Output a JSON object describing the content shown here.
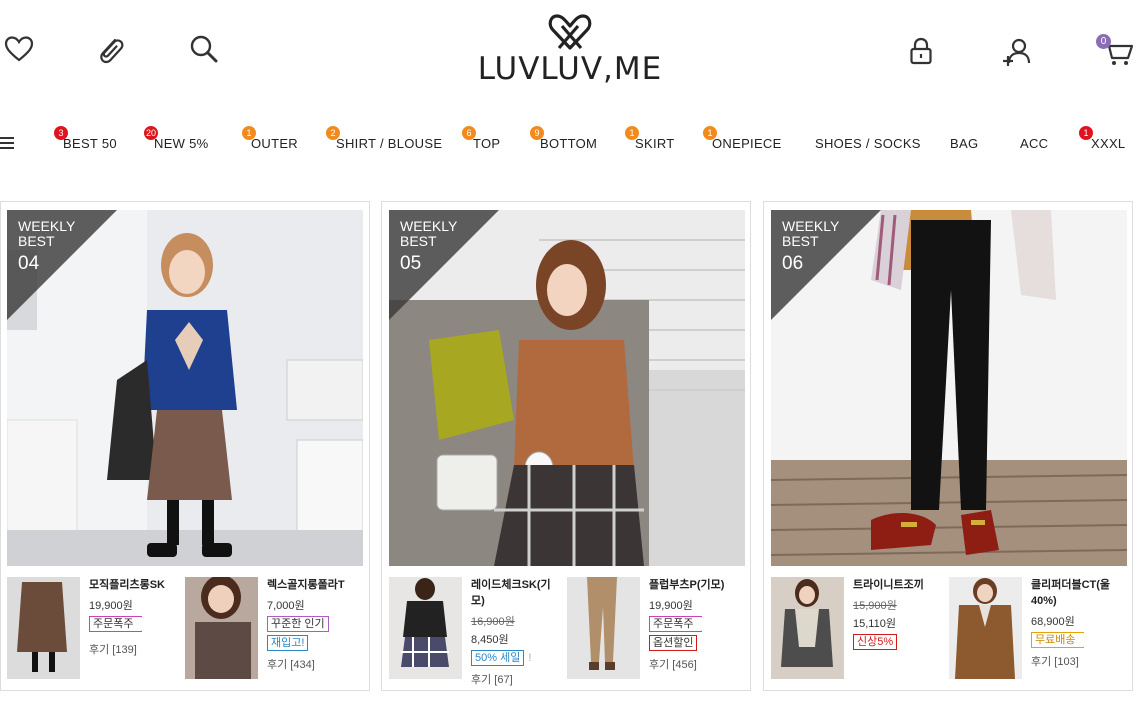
{
  "brand": {
    "name": "LUVLUV,ME"
  },
  "header": {
    "left_icons": [
      "heart-icon",
      "paperclip-icon",
      "search-icon"
    ],
    "right_icons": [
      "lock-icon",
      "add-user-icon",
      "cart-icon"
    ],
    "cart_count": "0"
  },
  "nav": {
    "items": [
      {
        "label": "BEST 50",
        "badge": "3",
        "badge_color": "#e0141e"
      },
      {
        "label": "NEW 5%",
        "badge": "20",
        "badge_color": "#e0141e"
      },
      {
        "label": "OUTER",
        "badge": "1",
        "badge_color": "#f28a1e"
      },
      {
        "label": "SHIRT / BLOUSE",
        "badge": "2",
        "badge_color": "#f28a1e"
      },
      {
        "label": "TOP",
        "badge": "6",
        "badge_color": "#f28a1e"
      },
      {
        "label": "BOTTOM",
        "badge": "9",
        "badge_color": "#f28a1e"
      },
      {
        "label": "SKIRT",
        "badge": "1",
        "badge_color": "#f28a1e"
      },
      {
        "label": "ONEPIECE",
        "badge": "1",
        "badge_color": "#f28a1e"
      },
      {
        "label": "SHOES / SOCKS",
        "badge": "",
        "badge_color": ""
      },
      {
        "label": "BAG",
        "badge": "",
        "badge_color": ""
      },
      {
        "label": "ACC",
        "badge": "",
        "badge_color": ""
      },
      {
        "label": "XXXL",
        "badge": "1",
        "badge_color": "#e0141e"
      }
    ]
  },
  "cards": [
    {
      "weekly_label": "WEEKLY BEST",
      "rank": "04",
      "subs": [
        {
          "name": "모직플리츠롱SK",
          "price_old": "",
          "price": "19,900원",
          "tags": [
            "주문폭주"
          ],
          "review": "후기 [139]"
        },
        {
          "name": "렉스골지롱폴라T",
          "price_old": "",
          "price": "7,000원",
          "tags": [
            "꾸준한 인기",
            "재입고!"
          ],
          "review": "후기 [434]"
        }
      ]
    },
    {
      "weekly_label": "WEEKLY BEST",
      "rank": "05",
      "subs": [
        {
          "name": "레이드체크SK(기모)",
          "price_old": "16,900원",
          "price": "8,450원",
          "tags": [
            "50% 세일"
          ],
          "extra": "!",
          "review": "후기 [67]"
        },
        {
          "name": "플럽부츠P(기모)",
          "price_old": "",
          "price": "19,900원",
          "tags": [
            "주문폭주",
            "옵션할인"
          ],
          "review": "후기 [456]"
        }
      ]
    },
    {
      "weekly_label": "WEEKLY BEST",
      "rank": "06",
      "subs": [
        {
          "name": "트라이니트조끼",
          "price_old": "15,900원",
          "price": "15,110원",
          "tags": [
            "신상5%"
          ],
          "review": ""
        },
        {
          "name": "클리퍼더블CT(울40%)",
          "price_old": "",
          "price": "68,900원",
          "tags": [
            "무료배송"
          ],
          "review": "후기 [103]"
        }
      ]
    }
  ]
}
